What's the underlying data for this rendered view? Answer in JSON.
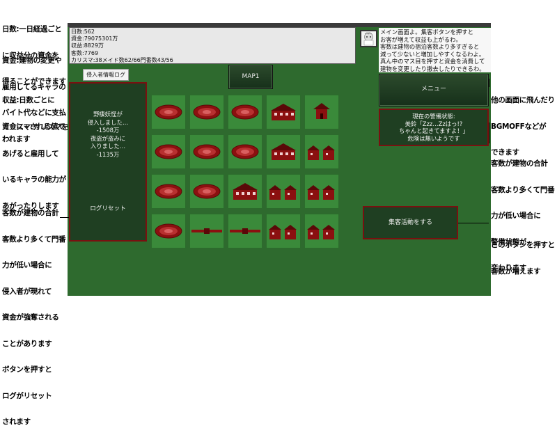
{
  "annotations": {
    "days_note": [
      "日数:一日経過ごと",
      "に収益分の資金を",
      "得ることができます"
    ],
    "funds_note": [
      "資金:建物の変更や",
      "雇用してるキャラの",
      "バイト代などに支払",
      "われます"
    ],
    "income_note": [
      "収益:日数ごとに",
      "資金に+される値です"
    ],
    "charisma_note": [
      "カリスマ:カリスマを",
      "あげると雇用して",
      "いるキャラの能力が",
      "あがったりします"
    ],
    "intruder_note": [
      "客数が建物の合計",
      "客数より多くて門番",
      "力が低い場合に",
      "侵入者が現れて",
      "資金が強奪される",
      "ことがあります",
      "ボタンを押すと",
      "ログがリセット",
      "されます"
    ],
    "menu_note": [
      "他の画面に飛んだり",
      "BGMOFFなどが",
      "できます"
    ],
    "alert_note": [
      "客数が建物の合計",
      "客数より多くて門番",
      "力が低い場合に",
      "警備状態が",
      "変わります"
    ],
    "gather_note": [
      "このボタンを押すと",
      "客数が増えます"
    ]
  },
  "status": {
    "days": "日数:562",
    "funds": "資金:79075301万",
    "income": "収益:8829万",
    "guests": "客数:7769",
    "charisma": "カリスマ:38メイド数62/66門番数43/56"
  },
  "message": [
    "メイン画面よ。集客ボタンを押すと",
    "お客が増えて収益も上がるわ。",
    "客数は建物の宿泊客数より多すぎると",
    "減って少ないと増加しやすくなるわよ。",
    "真ん中のマス目を押すと資金を消費して",
    "建物を変更したり撤去したりできるわ。"
  ],
  "buttons": {
    "log_label": "侵入者情報ログ",
    "map": "MAP1",
    "menu": "メニュー",
    "log_reset": "ログリセット",
    "gather": "集客活動をする"
  },
  "log": [
    "野棲妖怪が",
    "侵入しました…",
    "-1508万",
    "夜盗が盗みに",
    "入りました…",
    "-1135万"
  ],
  "alert": [
    "現在の警備状態:",
    "美鈴「Zzz…Zzはっ!?",
    "ちゃんと起きてますよ！」",
    "危険は無いようです"
  ],
  "grid": [
    [
      "plaza",
      "plaza",
      "plaza",
      "inn",
      "shrine"
    ],
    [
      "plaza",
      "plaza",
      "plaza",
      "inn",
      "houses"
    ],
    [
      "plaza",
      "plaza",
      "inn",
      "houses",
      "houses"
    ],
    [
      "plaza",
      "fence",
      "fence",
      "houses",
      "houses"
    ]
  ],
  "colors": {
    "field": "#2e6a2e",
    "tile": "#3a8a3a",
    "building": "#8b1010",
    "alert_border": "#7a1010"
  }
}
